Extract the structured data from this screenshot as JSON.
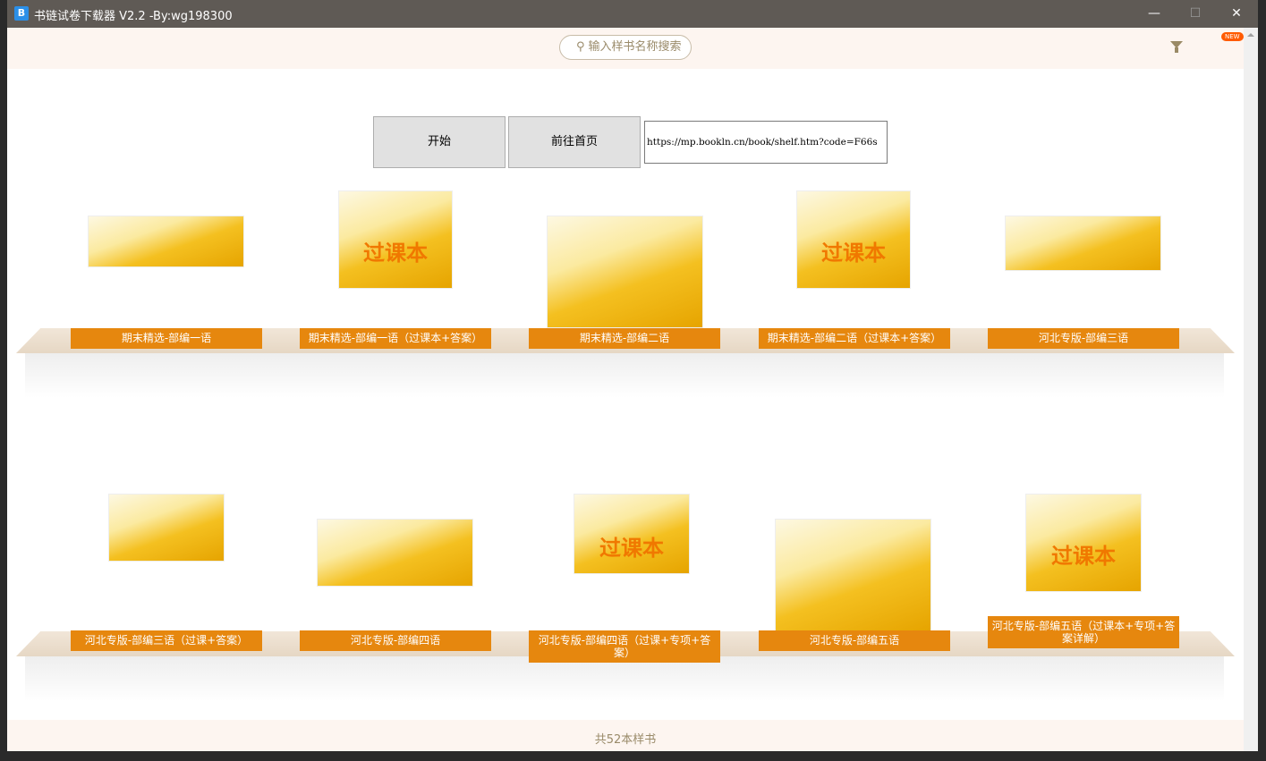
{
  "window": {
    "title": "书链试卷下载器 V2.2 -By:wg198300",
    "icon": "B",
    "minimize": "—",
    "maximize": "☐",
    "close": "✕"
  },
  "header": {
    "search_placeholder": "输入样书名称搜索",
    "new_badge": "NEW"
  },
  "toolbar": {
    "start": "开始",
    "home": "前往首页",
    "url": "https://mp.bookln.cn/book/shelf.htm?code=F66s"
  },
  "books": [
    {
      "label": "期末精选-部编一语",
      "cover_text": ""
    },
    {
      "label": "期末精选-部编一语（过课本+答案）",
      "cover_text": "过课本"
    },
    {
      "label": "期末精选-部编二语",
      "cover_text": ""
    },
    {
      "label": "期末精选-部编二语（过课本+答案）",
      "cover_text": "过课本"
    },
    {
      "label": "河北专版-部编三语",
      "cover_text": ""
    },
    {
      "label": "河北专版-部编三语（过课+答案）",
      "cover_text": ""
    },
    {
      "label": "河北专版-部编四语",
      "cover_text": ""
    },
    {
      "label": "河北专版-部编四语（过课+专项+答案）",
      "cover_text": "过课本"
    },
    {
      "label": "河北专版-部编五语",
      "cover_text": ""
    },
    {
      "label": "河北专版-部编五语（过课本+专项+答案详解）",
      "cover_text": "过课本"
    }
  ],
  "footer": {
    "count": "共52本样书"
  }
}
